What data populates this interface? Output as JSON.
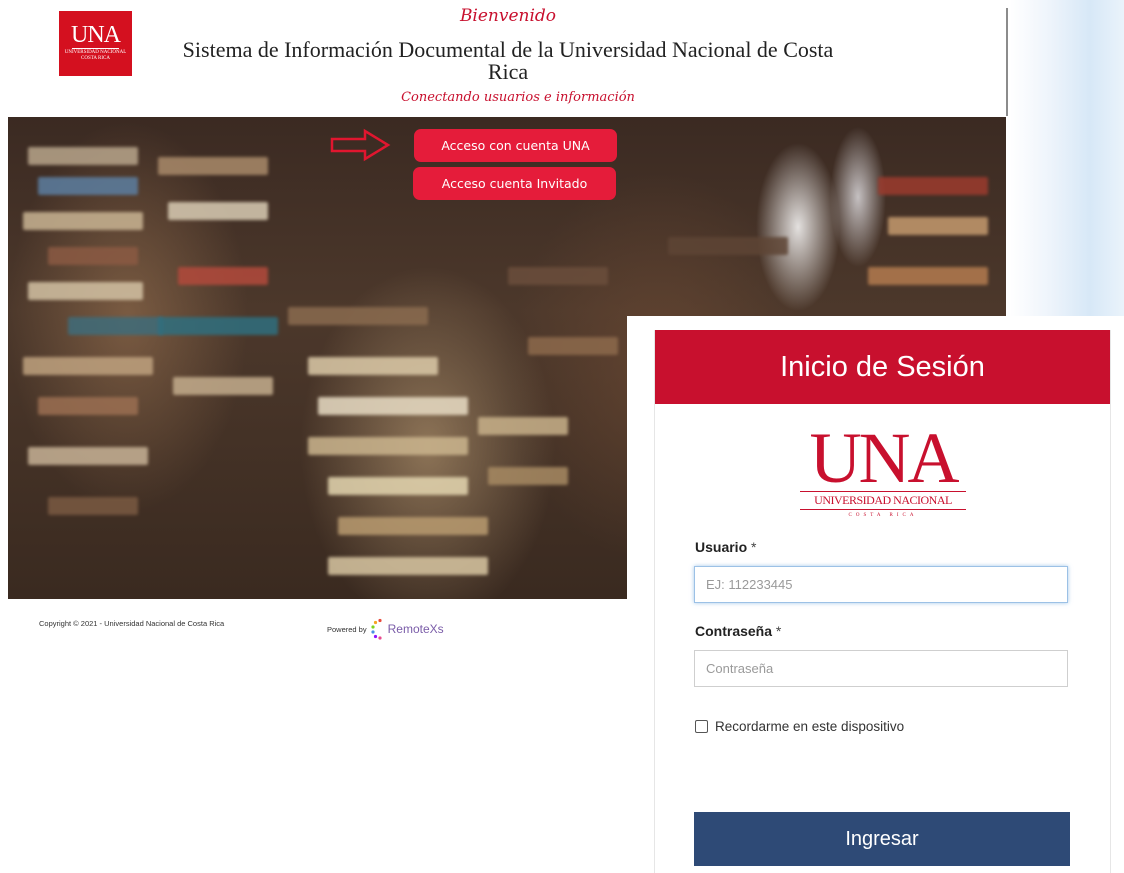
{
  "portal": {
    "logo": {
      "big": "UNA",
      "small": "UNIVERSIDAD NACIONAL COSTA RICA"
    },
    "welcome": "Bienvenido",
    "title": "Sistema de Información Documental de la Universidad Nacional de Costa Rica",
    "tagline": "Conectando usuarios e información",
    "buttons": {
      "una_account": "Acceso con cuenta UNA",
      "guest_account": "Acceso cuenta Invitado"
    },
    "footer": {
      "copyright": "Copyright © 2021 - Universidad Nacional de Costa Rica",
      "powered_by": "Powered by",
      "powered_brand": "RemoteXs"
    },
    "hero_icon": "arrow-right-outline-icon",
    "colors": {
      "brand_red": "#c8102e",
      "button_red": "#e51c3a"
    }
  },
  "login": {
    "header": "Inicio de Sesión",
    "logo": {
      "big": "UNA",
      "mid": "UNIVERSIDAD NACIONAL",
      "sub": "COSTA RICA"
    },
    "user_label": "Usuario",
    "user_placeholder": "EJ: 112233445",
    "password_label": "Contraseña",
    "password_placeholder": "Contraseña",
    "required_mark": "*",
    "remember_label": "Recordarme en este dispositivo",
    "submit": "Ingresar",
    "colors": {
      "header_red": "#c8102e",
      "submit_blue": "#2e4a76"
    }
  }
}
